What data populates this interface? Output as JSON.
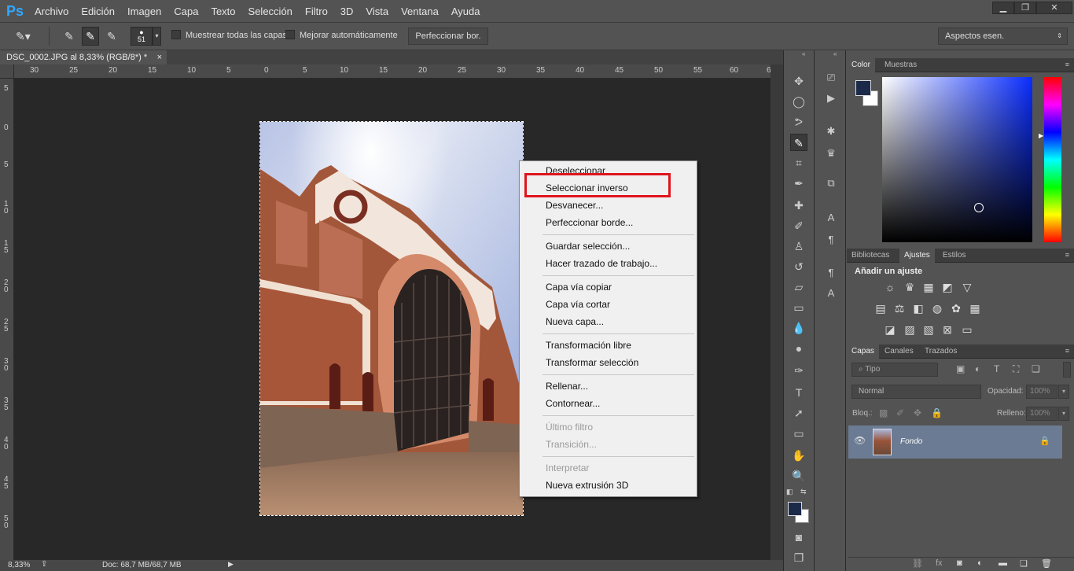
{
  "app": {
    "logo": "Ps"
  },
  "menu": [
    "Archivo",
    "Edición",
    "Imagen",
    "Capa",
    "Texto",
    "Selección",
    "Filtro",
    "3D",
    "Vista",
    "Ventana",
    "Ayuda"
  ],
  "window_controls": {
    "minimize": "▁",
    "restore": "❐",
    "close": "✕"
  },
  "options": {
    "brush_size": "51",
    "sample_all_layers": "Muestrear todas las capas",
    "auto_enhance": "Mejorar automáticamente",
    "refine_button": "Perfeccionar bor.",
    "workspace": "Aspectos esen."
  },
  "document": {
    "tab_title": "DSC_0002.JPG al 8,33% (RGB/8*) *",
    "close": "×",
    "zoom": "8,33%",
    "doc_size": "Doc: 68,7 MB/68,7 MB"
  },
  "hruler": [
    "30",
    "25",
    "20",
    "15",
    "10",
    "5",
    "0",
    "5",
    "10",
    "15",
    "20",
    "25",
    "30",
    "35",
    "40",
    "45",
    "50",
    "55",
    "60",
    "6"
  ],
  "vruler": [
    "5",
    "0",
    "5",
    "1\n0",
    "1\n5",
    "2\n0",
    "2\n5",
    "3\n0",
    "3\n5",
    "4\n0",
    "4\n5",
    "5\n0"
  ],
  "context_menu": {
    "items": [
      {
        "label": "Deseleccionar",
        "disabled": false
      },
      {
        "label": "Seleccionar inverso",
        "disabled": false
      },
      {
        "label": "Desvanecer...",
        "disabled": false
      },
      {
        "label": "Perfeccionar borde...",
        "disabled": false
      },
      {
        "label": "Guardar selección...",
        "disabled": false
      },
      {
        "label": "Hacer trazado de trabajo...",
        "disabled": false
      },
      {
        "label": "Capa vía copiar",
        "disabled": false
      },
      {
        "label": "Capa vía cortar",
        "disabled": false
      },
      {
        "label": "Nueva capa...",
        "disabled": false
      },
      {
        "label": "Transformación libre",
        "disabled": false
      },
      {
        "label": "Transformar selección",
        "disabled": false
      },
      {
        "label": "Rellenar...",
        "disabled": false
      },
      {
        "label": "Contornear...",
        "disabled": false
      },
      {
        "label": "Último filtro",
        "disabled": true
      },
      {
        "label": "Transición...",
        "disabled": true
      },
      {
        "label": "Interpretar",
        "disabled": true
      },
      {
        "label": "Nueva extrusión 3D",
        "disabled": false
      }
    ]
  },
  "panels": {
    "color_tabs": [
      "Color",
      "Muestras"
    ],
    "adjust_tabs": [
      "Bibliotecas",
      "Ajustes",
      "Estilos"
    ],
    "adjust_title": "Añadir un ajuste",
    "layers_tabs": [
      "Capas",
      "Canales",
      "Trazados"
    ],
    "kind_placeholder": "Tipo",
    "blend_mode": "Normal",
    "opacity_label": "Opacidad:",
    "opacity_value": "100%",
    "lock_label": "Bloq.:",
    "fill_label": "Relleno:",
    "fill_value": "100%",
    "layer_name": "Fondo"
  },
  "colors": {
    "foreground": "#1c2a4a",
    "background": "#ffffff",
    "accent": "#31a8ff",
    "highlight": "#e0141e"
  }
}
